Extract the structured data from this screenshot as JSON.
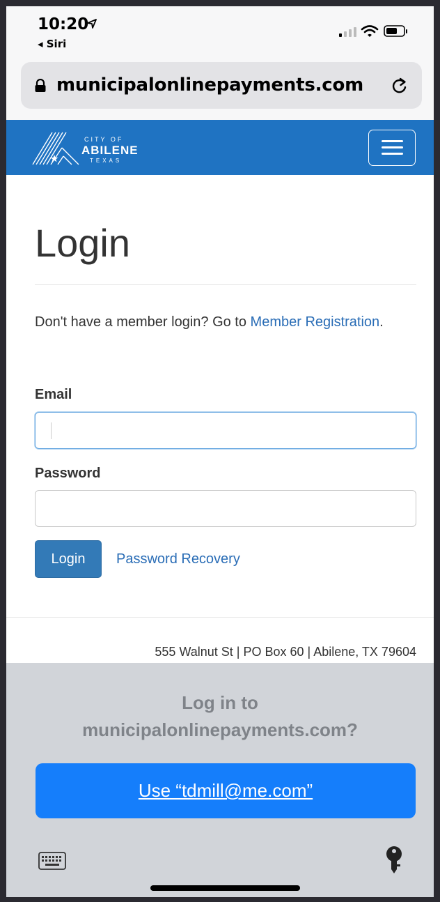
{
  "status_bar": {
    "time": "10:20",
    "back_label": "◂ Siri",
    "icons": [
      "location-arrow-icon",
      "cellular-signal-icon",
      "wifi-icon",
      "battery-icon"
    ]
  },
  "browser": {
    "url": "municipalonlinepayments.com",
    "icons": [
      "lock-icon",
      "reload-icon"
    ]
  },
  "site_header": {
    "logo": {
      "line1": "CITY OF",
      "line2": "ABILENE",
      "line3": "TEXAS"
    },
    "menu_icon": "hamburger-menu-icon",
    "brand_color": "#1f73c2"
  },
  "content": {
    "title": "Login",
    "registration": {
      "prefix": "Don't have a member login? Go to ",
      "link": "Member Registration",
      "suffix": "."
    },
    "email_label": "Email",
    "email_value": "",
    "password_label": "Password",
    "password_value": "",
    "login_button": "Login",
    "recovery_link": "Password Recovery",
    "accent_color": "#337ab7"
  },
  "footer": {
    "address": "555 Walnut St | PO Box 60 | Abilene, TX 79604"
  },
  "autofill": {
    "prompt_line1": "Log in to",
    "prompt_line2": "municipalonlinepayments.com?",
    "use_button": "Use “tdmill@me.com”",
    "icons": [
      "keyboard-icon",
      "key-icon"
    ],
    "button_color": "#157efb"
  }
}
